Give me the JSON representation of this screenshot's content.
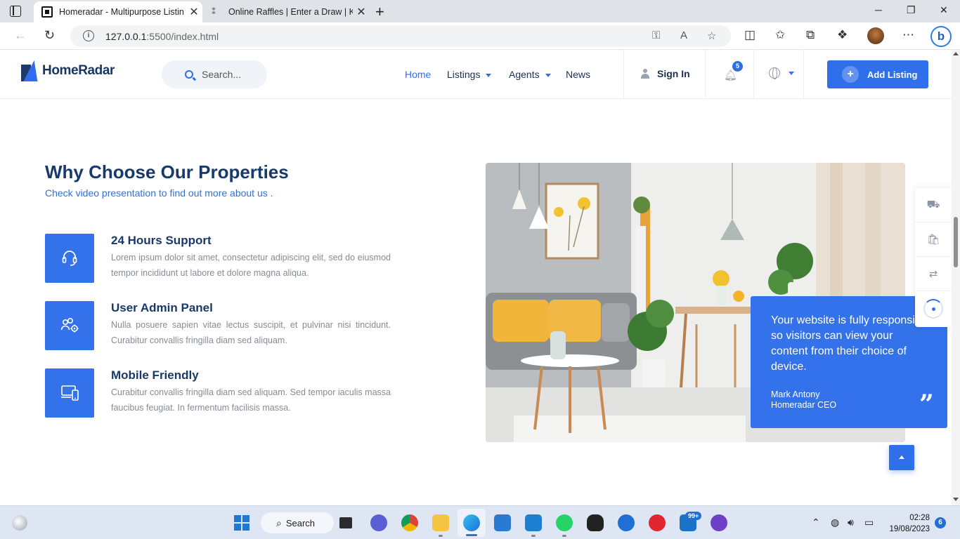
{
  "browser": {
    "tabs": [
      {
        "title": "Homeradar - Multipurpose Listin",
        "close": "✕",
        "active": true
      },
      {
        "title": "Online Raffles | Enter a Draw | Ko",
        "close": "✕",
        "active": false
      }
    ],
    "new_tab": "+",
    "window_controls": {
      "minimize": "─",
      "maximize": "❐",
      "close": "✕"
    },
    "url_host": "127.0.0.1",
    "url_path": ":5500/index.html",
    "bing": "b"
  },
  "site": {
    "logo": "HomeRadar",
    "search_placeholder": "Search...",
    "nav": [
      {
        "label": "Home"
      },
      {
        "label": "Listings"
      },
      {
        "label": "Agents"
      },
      {
        "label": "News"
      }
    ],
    "sign_in": "Sign In",
    "notification_count": "5",
    "add_listing": "Add Listing",
    "add_icon": "+"
  },
  "section": {
    "title": "Why Choose Our Properties",
    "subtitle": "Check video presentation to find out more about us .",
    "features": [
      {
        "icon": "headset-icon",
        "title": "24 Hours Support",
        "text": "Lorem ipsum dolor sit amet, consectetur adipiscing elit, sed do eiusmod tempor incididunt ut labore et dolore magna aliqua."
      },
      {
        "icon": "users-gear-icon",
        "title": "User Admin Panel",
        "text": "Nulla posuere sapien vitae lectus suscipit, et pulvinar nisi tincidunt. Curabitur convallis fringilla diam sed aliquam."
      },
      {
        "icon": "devices-icon",
        "title": "Mobile Friendly",
        "text": "Curabitur convallis fringilla diam sed aliquam. Sed tempor iaculis massa faucibus feugiat. In fermentum facilisis massa."
      }
    ],
    "quote": {
      "text": "Your website is fully responsive so visitors can view your content from their choice of device.",
      "name": "Mark Antony",
      "role": "Homeradar CEO",
      "mark": "”"
    }
  },
  "side_panel": {
    "items": [
      "delivery-icon",
      "shopping-bag-icon",
      "compare-arrows-icon",
      "progress-icon"
    ],
    "glyphs": [
      "⛟",
      "🛍",
      "⇄"
    ]
  },
  "taskbar": {
    "search_label": "Search",
    "search_glyph": "⌕",
    "badge": "99+",
    "time": "02:28",
    "date": "19/08/2023",
    "notifications": "6"
  },
  "colors": {
    "accent": "#3372ea",
    "heading": "#183a6b",
    "body_text": "#858c96"
  }
}
